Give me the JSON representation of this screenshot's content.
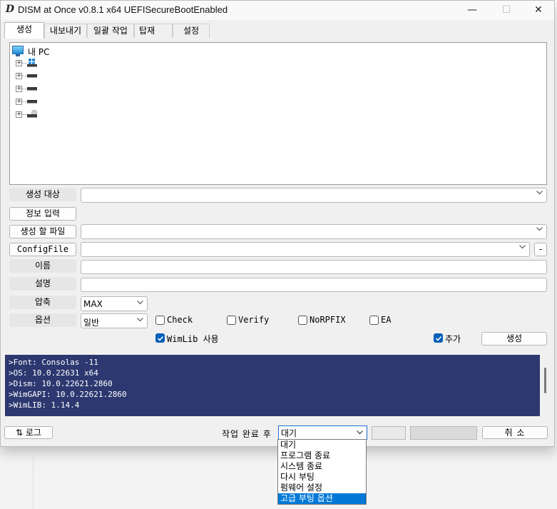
{
  "window": {
    "icon_letter": "D",
    "title": "DISM at Once v0.8.1 x64  UEFISecureBootEnabled",
    "minimize": "—",
    "maximize": "☐",
    "close": "✕"
  },
  "tabs": [
    "생성",
    "내보내기",
    "일괄 작업",
    "탑재",
    "설정"
  ],
  "tree": {
    "root_label": "내 PC"
  },
  "form": {
    "target_label": "생성 대상",
    "target_value": "",
    "info_button": "정보 입력",
    "file_label": "생성 할 파일",
    "file_value": "",
    "config_label": "ConfigFile",
    "config_value": "",
    "config_minus": "-",
    "name_label": "이름",
    "name_value": "",
    "desc_label": "설명",
    "desc_value": "",
    "compress_label": "압축",
    "compress_value": "MAX",
    "option_label": "옵션",
    "option_value": "일반",
    "checks": {
      "check": "Check",
      "verify": "Verify",
      "norpfix": "NoRPFIX",
      "ea": "EA",
      "wimlib": "WimLib 사용",
      "append": "추가"
    },
    "checks_state": {
      "check": false,
      "verify": false,
      "norpfix": false,
      "ea": false,
      "wimlib": true,
      "append": true
    },
    "create_button": "생성"
  },
  "log": [
    ">Font: Consolas -11",
    ">OS: 10.0.22631 x64",
    ">Dism: 10.0.22621.2860",
    ">WimGAPI: 10.0.22621.2860",
    ">WimLIB: 1.14.4"
  ],
  "bottom": {
    "log_button": "⇅ 로그",
    "after_label": "작업 완료 후",
    "after_value": "대기",
    "cancel_button": "취 소",
    "dropdown_options": [
      "대기",
      "프로그램 종료",
      "시스템 종료",
      "다시 부팅",
      "펌웨어 설정",
      "고급 부팅 옵션"
    ],
    "dropdown_selected_index": 5
  },
  "colors": {
    "log_bg": "#2d3870",
    "accent": "#005fb8",
    "highlight": "#0078d7"
  }
}
